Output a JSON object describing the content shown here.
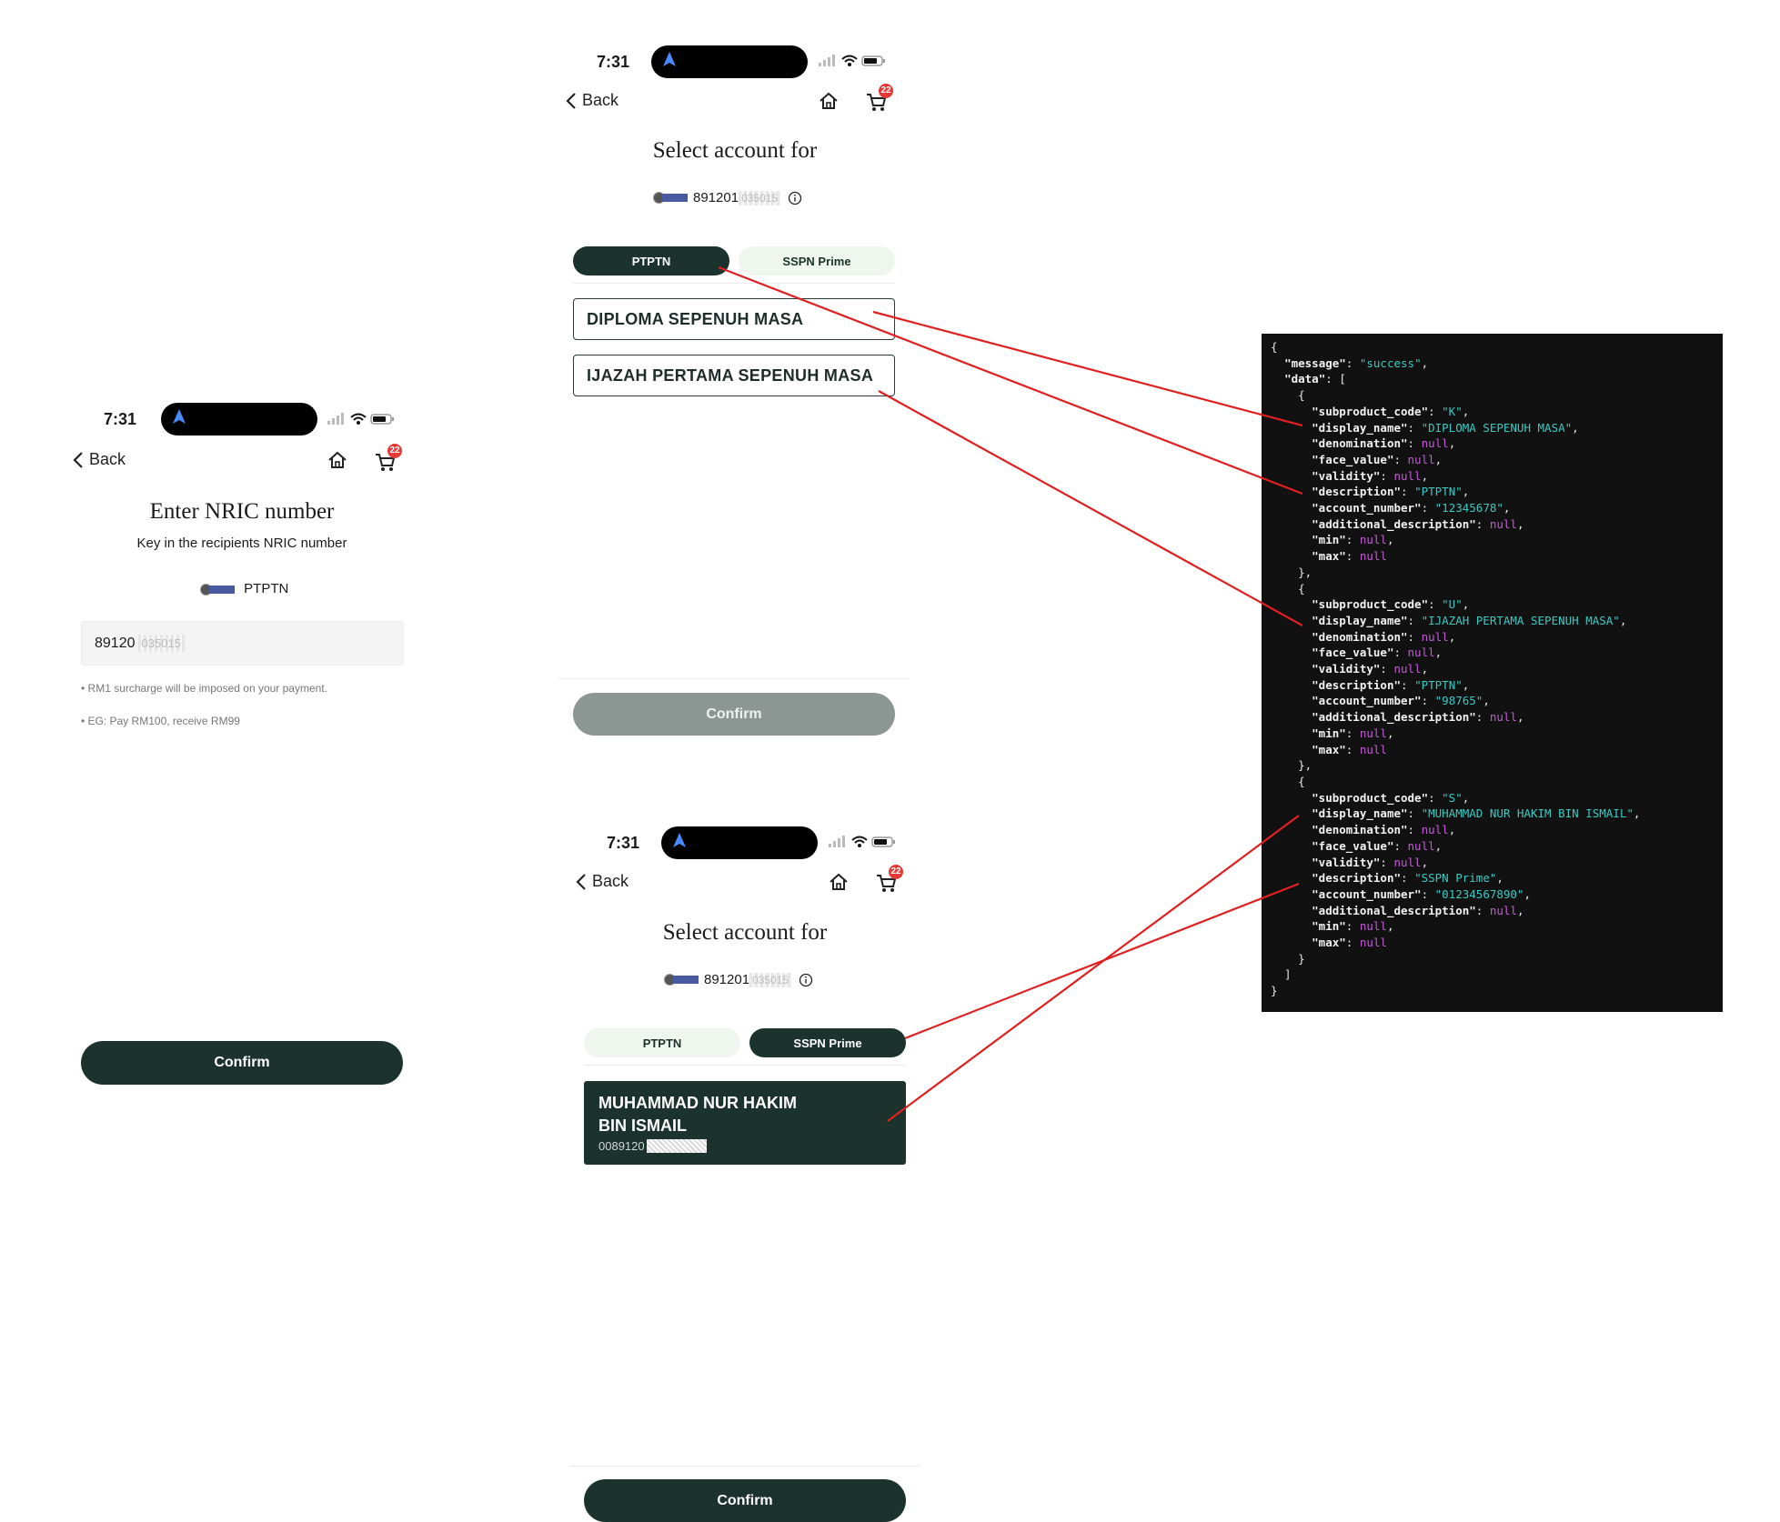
{
  "phone1": {
    "time": "7:31",
    "back_label": "Back",
    "cart_count": "22",
    "title": "Enter NRIC number",
    "subtitle": "Key in the recipients NRIC number",
    "product_name": "PTPTN",
    "nric_value": "89120",
    "nric_masked": "035015",
    "note1": "• RM1 surcharge will be imposed on your payment.",
    "note2": "• EG: Pay RM100, receive RM99",
    "confirm_label": "Confirm"
  },
  "phone2": {
    "time": "7:31",
    "back_label": "Back",
    "cart_count": "22",
    "title": "Select account for",
    "nric_value": "891201",
    "nric_masked": "035015",
    "tabs": [
      {
        "label": "PTPTN",
        "active": true
      },
      {
        "label": "SSPN Prime",
        "active": false
      }
    ],
    "accounts": [
      "DIPLOMA SEPENUH MASA",
      "IJAZAH PERTAMA SEPENUH MASA"
    ],
    "confirm_label": "Confirm"
  },
  "phone3": {
    "time": "7:31",
    "back_label": "Back",
    "cart_count": "22",
    "title": "Select account for",
    "nric_value": "891201",
    "nric_masked": "035015",
    "tabs": [
      {
        "label": "PTPTN",
        "active": false
      },
      {
        "label": "SSPN Prime",
        "active": true
      }
    ],
    "account_name_line1": "MUHAMMAD NUR HAKIM",
    "account_name_line2": "BIN ISMAIL",
    "account_number_prefix": "0089120",
    "confirm_label": "Confirm"
  },
  "json_response": {
    "lines": [
      [
        [
          "p",
          "{"
        ]
      ],
      [
        [
          "p",
          "  "
        ],
        [
          "k",
          "\"message\""
        ],
        [
          "p",
          ": "
        ],
        [
          "s",
          "\"success\""
        ],
        [
          "p",
          ","
        ]
      ],
      [
        [
          "p",
          "  "
        ],
        [
          "k",
          "\"data\""
        ],
        [
          "p",
          ": ["
        ]
      ],
      [
        [
          "p",
          "    {"
        ]
      ],
      [
        [
          "p",
          "      "
        ],
        [
          "k",
          "\"subproduct_code\""
        ],
        [
          "p",
          ": "
        ],
        [
          "s",
          "\"K\""
        ],
        [
          "p",
          ","
        ]
      ],
      [
        [
          "p",
          "      "
        ],
        [
          "k",
          "\"display_name\""
        ],
        [
          "p",
          ": "
        ],
        [
          "s",
          "\"DIPLOMA SEPENUH MASA\""
        ],
        [
          "p",
          ","
        ]
      ],
      [
        [
          "p",
          "      "
        ],
        [
          "k",
          "\"denomination\""
        ],
        [
          "p",
          ": "
        ],
        [
          "n",
          "null"
        ],
        [
          "p",
          ","
        ]
      ],
      [
        [
          "p",
          "      "
        ],
        [
          "k",
          "\"face_value\""
        ],
        [
          "p",
          ": "
        ],
        [
          "n",
          "null"
        ],
        [
          "p",
          ","
        ]
      ],
      [
        [
          "p",
          "      "
        ],
        [
          "k",
          "\"validity\""
        ],
        [
          "p",
          ": "
        ],
        [
          "n",
          "null"
        ],
        [
          "p",
          ","
        ]
      ],
      [
        [
          "p",
          "      "
        ],
        [
          "k",
          "\"description\""
        ],
        [
          "p",
          ": "
        ],
        [
          "s",
          "\"PTPTN\""
        ],
        [
          "p",
          ","
        ]
      ],
      [
        [
          "p",
          "      "
        ],
        [
          "k",
          "\"account_number\""
        ],
        [
          "p",
          ": "
        ],
        [
          "s",
          "\"12345678\""
        ],
        [
          "p",
          ","
        ]
      ],
      [
        [
          "p",
          "      "
        ],
        [
          "k",
          "\"additional_description\""
        ],
        [
          "p",
          ": "
        ],
        [
          "n",
          "null"
        ],
        [
          "p",
          ","
        ]
      ],
      [
        [
          "p",
          "      "
        ],
        [
          "k",
          "\"min\""
        ],
        [
          "p",
          ": "
        ],
        [
          "n",
          "null"
        ],
        [
          "p",
          ","
        ]
      ],
      [
        [
          "p",
          "      "
        ],
        [
          "k",
          "\"max\""
        ],
        [
          "p",
          ": "
        ],
        [
          "n",
          "null"
        ]
      ],
      [
        [
          "p",
          "    },"
        ]
      ],
      [
        [
          "p",
          "    {"
        ]
      ],
      [
        [
          "p",
          "      "
        ],
        [
          "k",
          "\"subproduct_code\""
        ],
        [
          "p",
          ": "
        ],
        [
          "s",
          "\"U\""
        ],
        [
          "p",
          ","
        ]
      ],
      [
        [
          "p",
          "      "
        ],
        [
          "k",
          "\"display_name\""
        ],
        [
          "p",
          ": "
        ],
        [
          "s",
          "\"IJAZAH PERTAMA SEPENUH MASA\""
        ],
        [
          "p",
          ","
        ]
      ],
      [
        [
          "p",
          "      "
        ],
        [
          "k",
          "\"denomination\""
        ],
        [
          "p",
          ": "
        ],
        [
          "n",
          "null"
        ],
        [
          "p",
          ","
        ]
      ],
      [
        [
          "p",
          "      "
        ],
        [
          "k",
          "\"face_value\""
        ],
        [
          "p",
          ": "
        ],
        [
          "n",
          "null"
        ],
        [
          "p",
          ","
        ]
      ],
      [
        [
          "p",
          "      "
        ],
        [
          "k",
          "\"validity\""
        ],
        [
          "p",
          ": "
        ],
        [
          "n",
          "null"
        ],
        [
          "p",
          ","
        ]
      ],
      [
        [
          "p",
          "      "
        ],
        [
          "k",
          "\"description\""
        ],
        [
          "p",
          ": "
        ],
        [
          "s",
          "\"PTPTN\""
        ],
        [
          "p",
          ","
        ]
      ],
      [
        [
          "p",
          "      "
        ],
        [
          "k",
          "\"account_number\""
        ],
        [
          "p",
          ": "
        ],
        [
          "s",
          "\"98765\""
        ],
        [
          "p",
          ","
        ]
      ],
      [
        [
          "p",
          "      "
        ],
        [
          "k",
          "\"additional_description\""
        ],
        [
          "p",
          ": "
        ],
        [
          "n",
          "null"
        ],
        [
          "p",
          ","
        ]
      ],
      [
        [
          "p",
          "      "
        ],
        [
          "k",
          "\"min\""
        ],
        [
          "p",
          ": "
        ],
        [
          "n",
          "null"
        ],
        [
          "p",
          ","
        ]
      ],
      [
        [
          "p",
          "      "
        ],
        [
          "k",
          "\"max\""
        ],
        [
          "p",
          ": "
        ],
        [
          "n",
          "null"
        ]
      ],
      [
        [
          "p",
          "    },"
        ]
      ],
      [
        [
          "p",
          "    {"
        ]
      ],
      [
        [
          "p",
          "      "
        ],
        [
          "k",
          "\"subproduct_code\""
        ],
        [
          "p",
          ": "
        ],
        [
          "s",
          "\"S\""
        ],
        [
          "p",
          ","
        ]
      ],
      [
        [
          "p",
          "      "
        ],
        [
          "k",
          "\"display_name\""
        ],
        [
          "p",
          ": "
        ],
        [
          "s",
          "\"MUHAMMAD NUR HAKIM BIN ISMAIL\""
        ],
        [
          "p",
          ","
        ]
      ],
      [
        [
          "p",
          "      "
        ],
        [
          "k",
          "\"denomination\""
        ],
        [
          "p",
          ": "
        ],
        [
          "n",
          "null"
        ],
        [
          "p",
          ","
        ]
      ],
      [
        [
          "p",
          "      "
        ],
        [
          "k",
          "\"face_value\""
        ],
        [
          "p",
          ": "
        ],
        [
          "n",
          "null"
        ],
        [
          "p",
          ","
        ]
      ],
      [
        [
          "p",
          "      "
        ],
        [
          "k",
          "\"validity\""
        ],
        [
          "p",
          ": "
        ],
        [
          "n",
          "null"
        ],
        [
          "p",
          ","
        ]
      ],
      [
        [
          "p",
          "      "
        ],
        [
          "k",
          "\"description\""
        ],
        [
          "p",
          ": "
        ],
        [
          "s",
          "\"SSPN Prime\""
        ],
        [
          "p",
          ","
        ]
      ],
      [
        [
          "p",
          "      "
        ],
        [
          "k",
          "\"account_number\""
        ],
        [
          "p",
          ": "
        ],
        [
          "s",
          "\"01234567890\""
        ],
        [
          "p",
          ","
        ]
      ],
      [
        [
          "p",
          "      "
        ],
        [
          "k",
          "\"additional_description\""
        ],
        [
          "p",
          ": "
        ],
        [
          "n",
          "null"
        ],
        [
          "p",
          ","
        ]
      ],
      [
        [
          "p",
          "      "
        ],
        [
          "k",
          "\"min\""
        ],
        [
          "p",
          ": "
        ],
        [
          "n",
          "null"
        ],
        [
          "p",
          ","
        ]
      ],
      [
        [
          "p",
          "      "
        ],
        [
          "k",
          "\"max\""
        ],
        [
          "p",
          ": "
        ],
        [
          "n",
          "null"
        ]
      ],
      [
        [
          "p",
          "    }"
        ]
      ],
      [
        [
          "p",
          "  ]"
        ]
      ],
      [
        [
          "p",
          "}"
        ]
      ]
    ]
  },
  "colors": {
    "primary_dark": "#1c332d",
    "tab_inactive_bg": "#eef6ee",
    "disabled_button": "#8c9793",
    "badge_red": "#e53935",
    "connector_red": "#e02020",
    "code_bg": "#111111",
    "code_string": "#3bc9c4",
    "code_null": "#c35bd6"
  }
}
